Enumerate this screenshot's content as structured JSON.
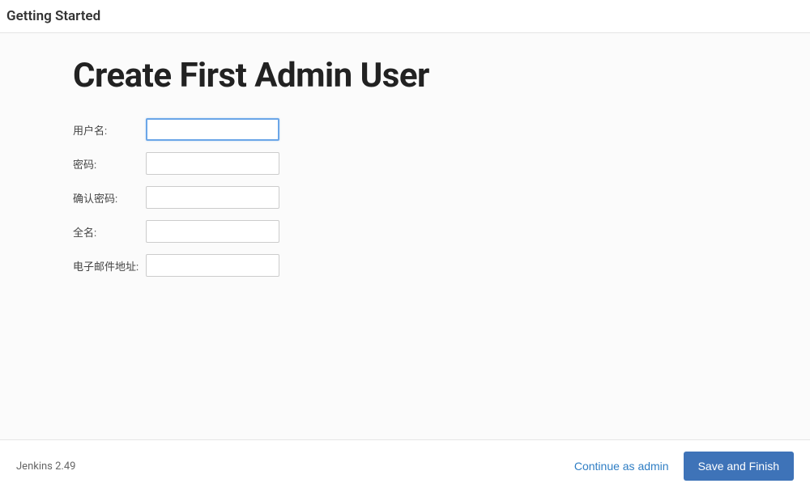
{
  "header": {
    "title": "Getting Started"
  },
  "main": {
    "heading": "Create First Admin User",
    "form": {
      "fields": [
        {
          "label": "用户名:",
          "value": "",
          "focused": true,
          "type": "text"
        },
        {
          "label": "密码:",
          "value": "",
          "focused": false,
          "type": "password"
        },
        {
          "label": "确认密码:",
          "value": "",
          "focused": false,
          "type": "password"
        },
        {
          "label": "全名:",
          "value": "",
          "focused": false,
          "type": "text"
        },
        {
          "label": "电子邮件地址:",
          "value": "",
          "focused": false,
          "type": "text"
        }
      ]
    }
  },
  "footer": {
    "version": "Jenkins 2.49",
    "continueLabel": "Continue as admin",
    "saveLabel": "Save and Finish"
  }
}
